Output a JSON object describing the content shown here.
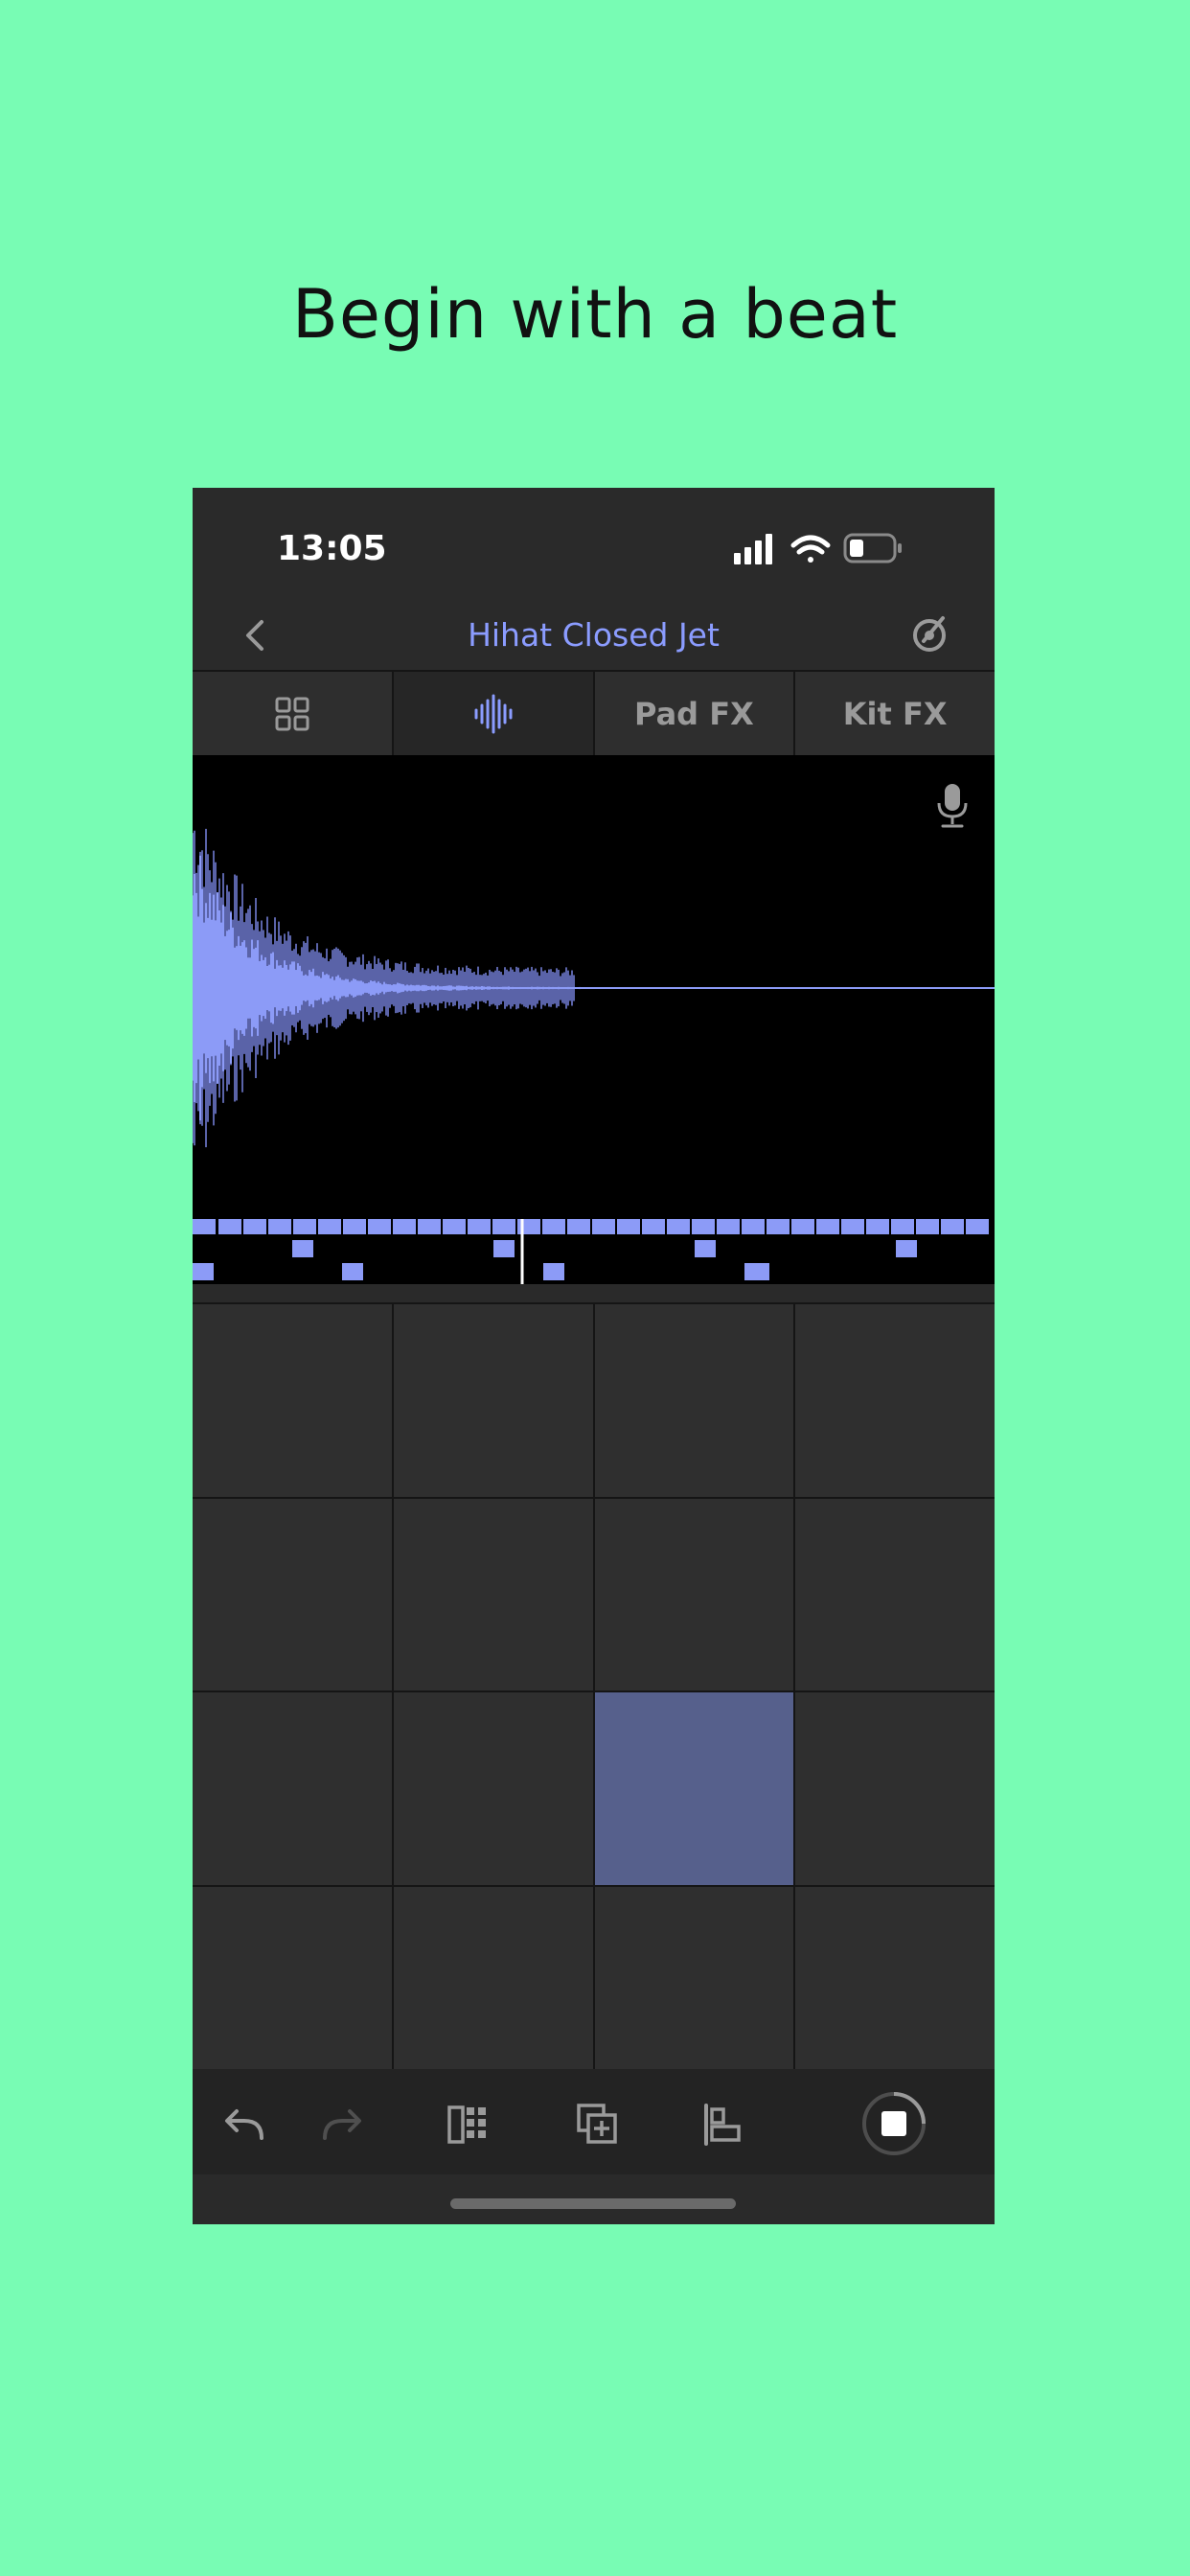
{
  "headline": "Begin with a beat",
  "status_bar": {
    "time": "13:05",
    "icons": [
      "signal-icon",
      "wifi-icon",
      "battery-icon"
    ]
  },
  "nav": {
    "title": "Hihat Closed Jet",
    "back_icon": "back-chevron-icon",
    "right_icon": "tune-icon"
  },
  "tabs": [
    {
      "label": "",
      "icon": "grid-icon",
      "active": false
    },
    {
      "label": "",
      "icon": "waveform-icon",
      "active": true
    },
    {
      "label": "Pad FX",
      "icon": "",
      "active": false
    },
    {
      "label": "Kit FX",
      "icon": "",
      "active": false
    }
  ],
  "waveform": {
    "color": "#8c9bf7",
    "record_icon": "microphone-icon"
  },
  "pads": {
    "count": 16,
    "active_index": 10,
    "active_color": "#56608c"
  },
  "toolbar": {
    "items": [
      "undo-icon",
      "redo-icon",
      "pattern-icon",
      "duplicate-icon",
      "align-icon",
      "stop-icon"
    ]
  },
  "colors": {
    "background": "#78fcb4",
    "accent": "#8b9cff",
    "panel": "#2a2a2a"
  }
}
